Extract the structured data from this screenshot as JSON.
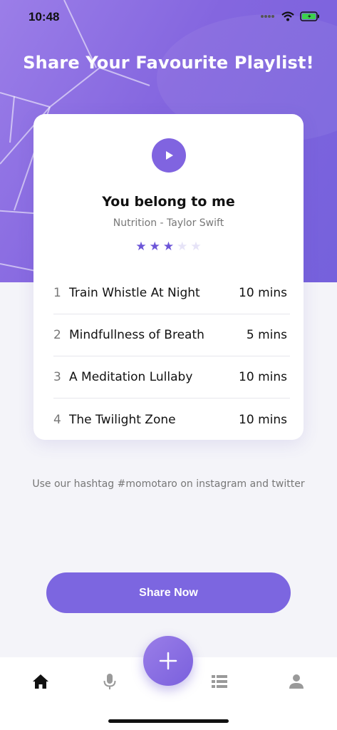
{
  "status_bar": {
    "time": "10:48"
  },
  "header": {
    "title": "Share Your Favourite Playlist!"
  },
  "card": {
    "song_title": "You belong to me",
    "song_subtitle": "Nutrition - Taylor Swift",
    "rating": {
      "value": 3,
      "max": 5
    },
    "tracks": [
      {
        "number": "1",
        "name": "Train Whistle At Night",
        "duration": "10 mins"
      },
      {
        "number": "2",
        "name": "Mindfullness of Breath",
        "duration": "5 mins"
      },
      {
        "number": "3",
        "name": "A Meditation Lullaby",
        "duration": "10 mins"
      },
      {
        "number": "4",
        "name": "The Twilight Zone",
        "duration": "10 mins"
      }
    ]
  },
  "hashtag_text": "Use our hashtag #momotaro on instagram and twitter",
  "share_button": {
    "label": "Share Now"
  },
  "tabbar": {
    "items": [
      {
        "icon": "home-icon",
        "active": true
      },
      {
        "icon": "microphone-icon",
        "active": false
      },
      {
        "icon": "plus-icon",
        "active": false
      },
      {
        "icon": "list-icon",
        "active": false
      },
      {
        "icon": "profile-icon",
        "active": false
      }
    ]
  },
  "colors": {
    "accent": "#7c66e0",
    "star_filled": "#6c55d8",
    "star_empty": "#e6e3f7",
    "tab_active": "#111111",
    "tab_inactive": "#9a9a9a"
  }
}
